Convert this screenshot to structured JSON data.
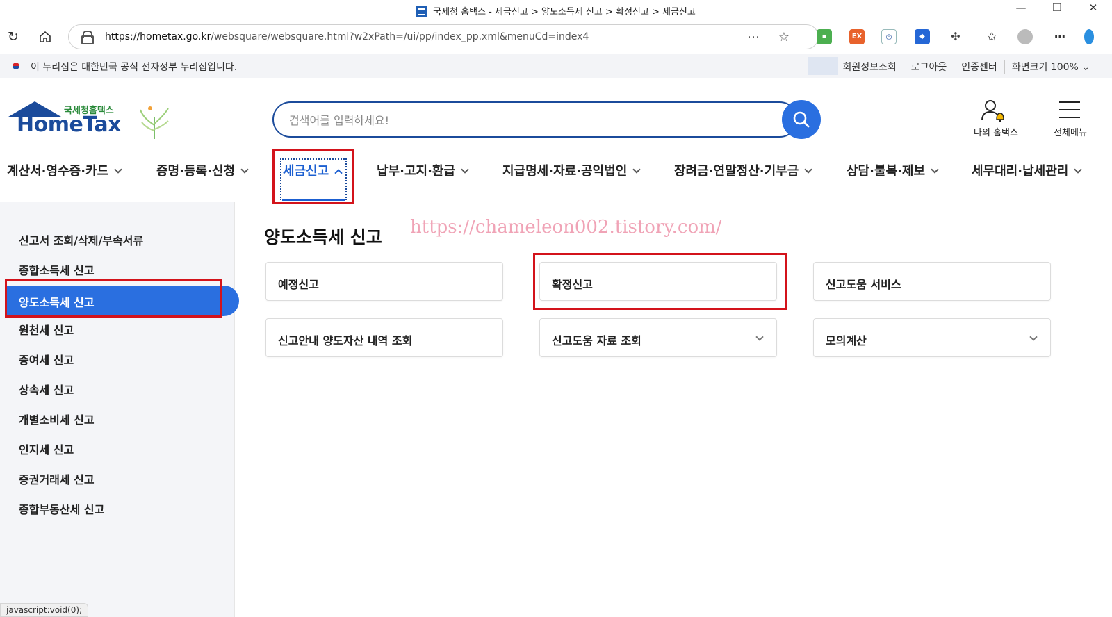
{
  "browser": {
    "window_title": "국세청 홈택스 - 세금신고 > 양도소득세 신고 > 확정신고 > 세금신고",
    "url_host": "https://hometax.go.kr",
    "url_path": "/websquare/websquare.html?w2xPath=/ui/pp/index_pp.xml&menuCd=index4",
    "status_text": "javascript:void(0);"
  },
  "gov_banner": {
    "message": "이 누리집은 대한민국 공식 전자정부 누리집입니다.",
    "links": [
      "회원정보조회",
      "로그아웃",
      "인증센터",
      "화면크기 100% ⌄"
    ]
  },
  "header": {
    "logo_main": "HomeTax",
    "logo_sub": "국세청홈택스",
    "search_placeholder": "검색어를 입력하세요!",
    "my_hometax": "나의 홈택스",
    "all_menu": "전체메뉴"
  },
  "gnb": {
    "items": [
      "계산서·영수증·카드",
      "증명·등록·신청",
      "세금신고",
      "납부·고지·환급",
      "지급명세·자료·공익법인",
      "장려금·연말정산·기부금",
      "상담·불복·제보",
      "세무대리·납세관리"
    ],
    "active_index": 2
  },
  "sidebar": {
    "items": [
      "신고서 조회/삭제/부속서류",
      "종합소득세 신고",
      "양도소득세 신고",
      "원천세 신고",
      "증여세 신고",
      "상속세 신고",
      "개별소비세 신고",
      "인지세 신고",
      "증권거래세 신고",
      "종합부동산세 신고"
    ],
    "active_index": 2
  },
  "main": {
    "title": "양도소득세 신고",
    "watermark": "https://chameleon002.tistory.com/",
    "cards": [
      {
        "label": "예정신고",
        "dropdown": false
      },
      {
        "label": "확정신고",
        "dropdown": false
      },
      {
        "label": "신고도움 서비스",
        "dropdown": false
      },
      {
        "label": "신고안내 양도자산 내역 조회",
        "dropdown": false
      },
      {
        "label": "신고도움 자료 조회",
        "dropdown": true
      },
      {
        "label": "모의계산",
        "dropdown": true
      }
    ]
  },
  "colors": {
    "brand_navy": "#1b4b9b",
    "accent_blue": "#2a6fe0",
    "highlight_red": "#d3131b"
  }
}
